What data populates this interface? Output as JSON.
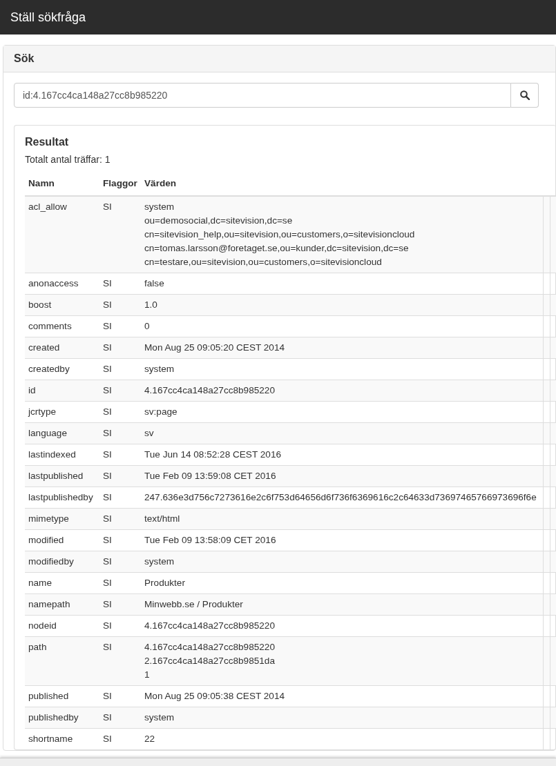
{
  "window": {
    "title": "Ställ sökfråga"
  },
  "search_panel": {
    "title": "Sök",
    "query": "id:4.167cc4ca148a27cc8b985220"
  },
  "results": {
    "title": "Resultat",
    "total": "Totalt antal träffar: 1",
    "columns": [
      "Namn",
      "Flaggor",
      "Värden"
    ],
    "rows": [
      {
        "name": "acl_allow",
        "flags": "SI",
        "values": [
          "system",
          "ou=demosocial,dc=sitevision,dc=se",
          "cn=sitevision_help,ou=sitevision,ou=customers,o=sitevisioncloud",
          "cn=tomas.larsson@foretaget.se,ou=kunder,dc=sitevision,dc=se",
          "cn=testare,ou=sitevision,ou=customers,o=sitevisioncloud"
        ]
      },
      {
        "name": "anonaccess",
        "flags": "SI",
        "values": [
          "false"
        ]
      },
      {
        "name": "boost",
        "flags": "SI",
        "values": [
          "1.0"
        ]
      },
      {
        "name": "comments",
        "flags": "SI",
        "values": [
          "0"
        ]
      },
      {
        "name": "created",
        "flags": "SI",
        "values": [
          "Mon Aug 25 09:05:20 CEST 2014"
        ]
      },
      {
        "name": "createdby",
        "flags": "SI",
        "values": [
          "system"
        ]
      },
      {
        "name": "id",
        "flags": "SI",
        "values": [
          "4.167cc4ca148a27cc8b985220"
        ]
      },
      {
        "name": "jcrtype",
        "flags": "SI",
        "values": [
          "sv:page"
        ]
      },
      {
        "name": "language",
        "flags": "SI",
        "values": [
          "sv"
        ]
      },
      {
        "name": "lastindexed",
        "flags": "SI",
        "values": [
          "Tue Jun 14 08:52:28 CEST 2016"
        ]
      },
      {
        "name": "lastpublished",
        "flags": "SI",
        "values": [
          "Tue Feb 09 13:59:08 CET 2016"
        ]
      },
      {
        "name": "lastpublishedby",
        "flags": "SI",
        "values": [
          "247.636e3d756c7273616e2c6f753d64656d6f736f6369616c2c64633d73697465766973696f6e"
        ]
      },
      {
        "name": "mimetype",
        "flags": "SI",
        "values": [
          "text/html"
        ]
      },
      {
        "name": "modified",
        "flags": "SI",
        "values": [
          "Tue Feb 09 13:58:09 CET 2016"
        ]
      },
      {
        "name": "modifiedby",
        "flags": "SI",
        "values": [
          "system"
        ]
      },
      {
        "name": "name",
        "flags": "SI",
        "values": [
          "Produkter"
        ]
      },
      {
        "name": "namepath",
        "flags": "SI",
        "values": [
          "Minwebb.se / Produkter"
        ]
      },
      {
        "name": "nodeid",
        "flags": "SI",
        "values": [
          "4.167cc4ca148a27cc8b985220"
        ]
      },
      {
        "name": "path",
        "flags": "SI",
        "values": [
          "4.167cc4ca148a27cc8b985220",
          "2.167cc4ca148a27cc8b9851da",
          "1"
        ]
      },
      {
        "name": "published",
        "flags": "SI",
        "values": [
          "Mon Aug 25 09:05:38 CEST 2014"
        ]
      },
      {
        "name": "publishedby",
        "flags": "SI",
        "values": [
          "system"
        ]
      },
      {
        "name": "shortname",
        "flags": "SI",
        "values": [
          "22"
        ]
      }
    ]
  }
}
